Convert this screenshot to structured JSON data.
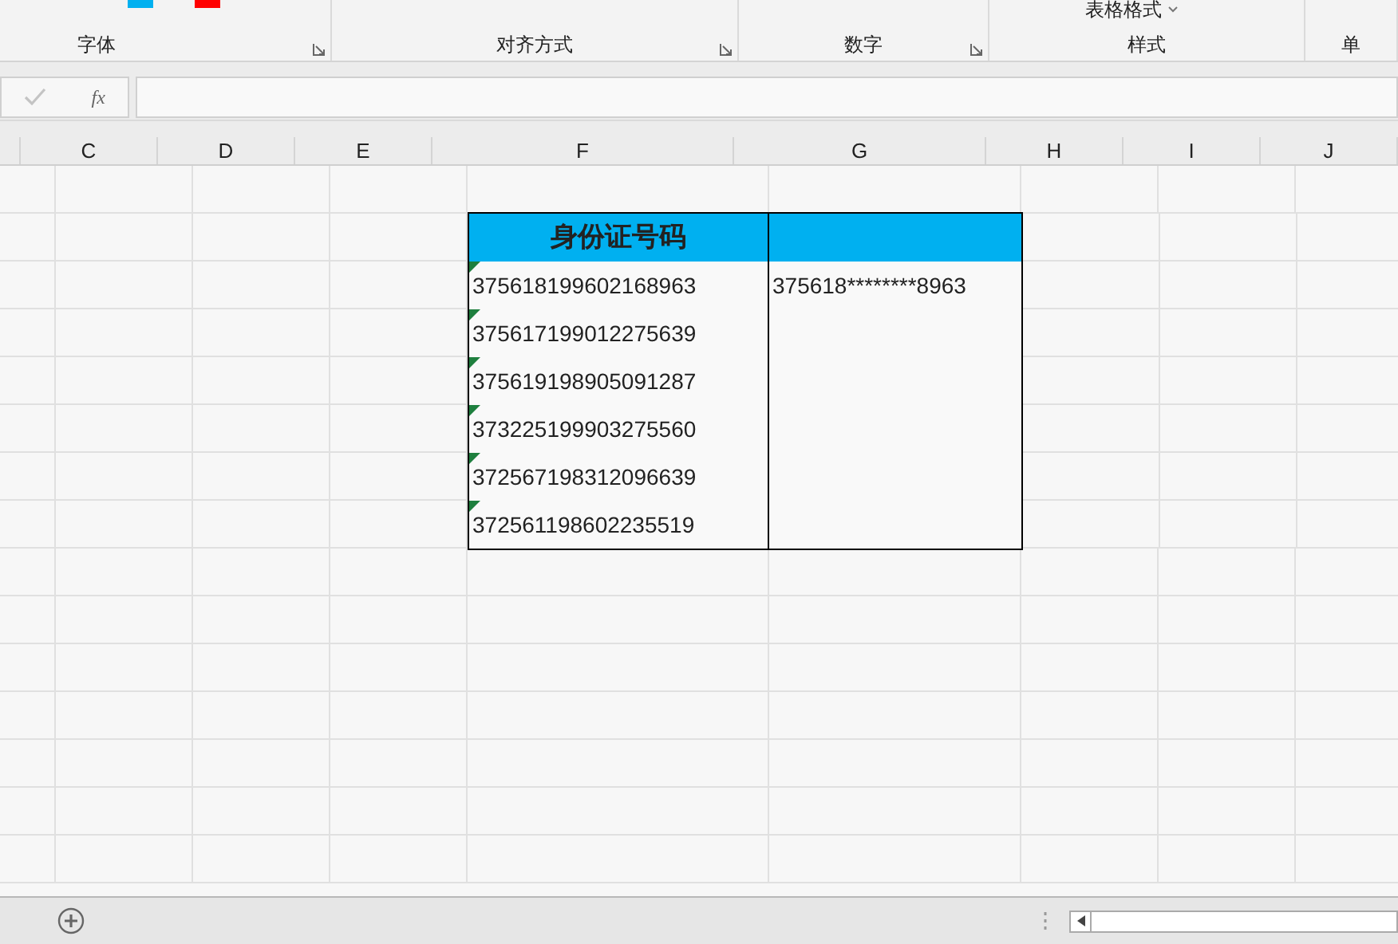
{
  "ribbon": {
    "groups": [
      {
        "label": "字体",
        "launcher": true
      },
      {
        "label": "对齐方式",
        "launcher": true
      },
      {
        "label": "数字",
        "launcher": true
      },
      {
        "label": "样式",
        "launcher": false,
        "button": "表格格式"
      },
      {
        "label": "单",
        "launcher": false
      }
    ]
  },
  "formula_bar": {
    "function_label": "fx"
  },
  "columns": [
    "C",
    "D",
    "E",
    "F",
    "G",
    "H",
    "I",
    "J"
  ],
  "table": {
    "header": [
      "身份证号码"
    ],
    "rows": [
      {
        "id": "375618199602168963",
        "masked": "375618********8963",
        "text_number": true
      },
      {
        "id": "375617199012275639",
        "text_number": true
      },
      {
        "id": "375619198905091287",
        "text_number": true
      },
      {
        "id": "373225199903275560",
        "text_number": true
      },
      {
        "id": "372567198312096639",
        "text_number": true
      },
      {
        "id": "372561198602235519",
        "text_number": true
      }
    ]
  }
}
